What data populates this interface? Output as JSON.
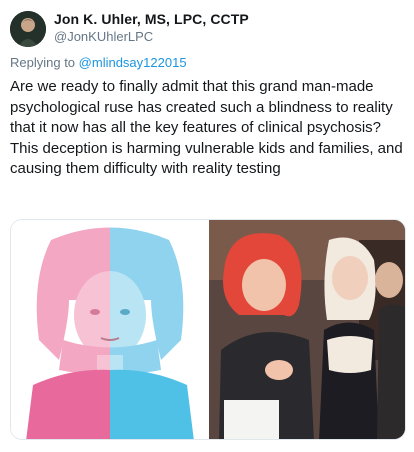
{
  "tweet": {
    "author": {
      "display_name": "Jon K. Uhler, MS, LPC, CCTP",
      "handle": "@JonKUhlerLPC"
    },
    "replying_to": {
      "prefix": "Replying to",
      "mention": "@mlindsay122015"
    },
    "text": "Are we ready to finally admit that this grand man-made psychological ruse has created such a blindness to reality that it now has all the key features of clinical psychosis? This deception is harming vulnerable kids and families, and causing them difficulty with reality testing"
  },
  "colors": {
    "text": "#14171a",
    "secondary": "#657786",
    "link": "#1b95e0",
    "pink": "#e86a9c",
    "blue": "#4fc1e6"
  }
}
